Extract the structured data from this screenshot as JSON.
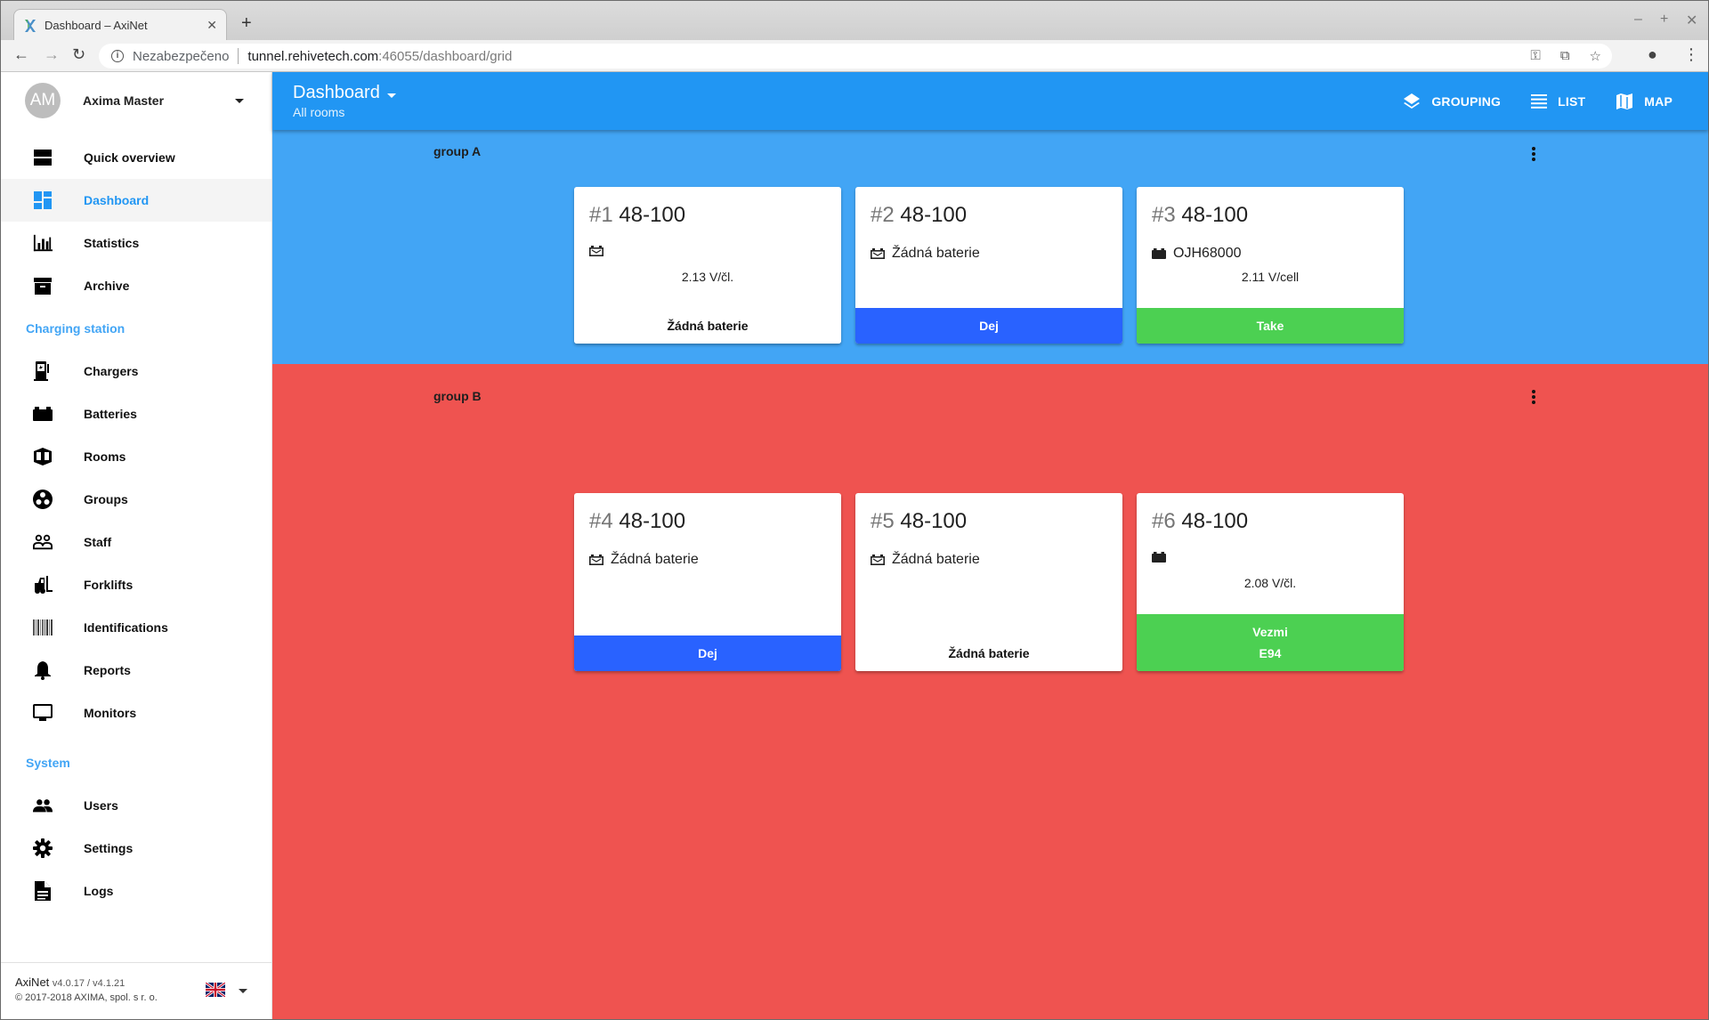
{
  "browser": {
    "tab_title": "Dashboard – AxiNet",
    "security_label": "Nezabezpečeno",
    "url_host": "tunnel.rehivetech.com",
    "url_path": ":46055/dashboard/grid"
  },
  "sidebar": {
    "user": {
      "initials": "AM",
      "name": "Axima Master"
    },
    "items_main": [
      {
        "label": "Quick overview",
        "icon": "view-agenda-icon",
        "active": false
      },
      {
        "label": "Dashboard",
        "icon": "dashboard-icon",
        "active": true
      },
      {
        "label": "Statistics",
        "icon": "bar-chart-icon",
        "active": false
      },
      {
        "label": "Archive",
        "icon": "archive-icon",
        "active": false
      }
    ],
    "section_charging": "Charging station",
    "items_charging": [
      {
        "label": "Chargers",
        "icon": "charger-icon"
      },
      {
        "label": "Batteries",
        "icon": "battery-icon"
      },
      {
        "label": "Rooms",
        "icon": "room-icon"
      },
      {
        "label": "Groups",
        "icon": "groups-icon"
      },
      {
        "label": "Staff",
        "icon": "staff-icon"
      },
      {
        "label": "Forklifts",
        "icon": "forklift-icon"
      },
      {
        "label": "Identifications",
        "icon": "barcode-icon"
      },
      {
        "label": "Reports",
        "icon": "bell-icon"
      },
      {
        "label": "Monitors",
        "icon": "monitor-icon"
      }
    ],
    "section_system": "System",
    "items_system": [
      {
        "label": "Users",
        "icon": "users-icon"
      },
      {
        "label": "Settings",
        "icon": "gear-icon"
      },
      {
        "label": "Logs",
        "icon": "document-icon"
      }
    ],
    "footer": {
      "app_name": "AxiNet",
      "version": "v4.0.17 / v4.1.21",
      "copyright": "© 2017-2018 AXIMA, spol. s r. o.",
      "language": "en-GB"
    }
  },
  "header": {
    "title": "Dashboard",
    "subtitle": "All rooms",
    "actions": [
      {
        "label": "GROUPING",
        "icon": "layers-icon"
      },
      {
        "label": "LIST",
        "icon": "list-icon"
      },
      {
        "label": "MAP",
        "icon": "map-icon"
      }
    ]
  },
  "groups": [
    {
      "name": "group A",
      "color": "#42A5F5",
      "chargers": [
        {
          "number": "#1",
          "model": "48-100",
          "battery_state": "empty",
          "battery_text": "",
          "voltage": "2.13 V/čl.",
          "action": "none",
          "action_label": "Žádná baterie",
          "action_sub": ""
        },
        {
          "number": "#2",
          "model": "48-100",
          "battery_state": "empty",
          "battery_text": "Žádná baterie",
          "voltage": "",
          "action": "give",
          "action_label": "Dej",
          "action_sub": ""
        },
        {
          "number": "#3",
          "model": "48-100",
          "battery_state": "present",
          "battery_text": "OJH68000",
          "voltage": "2.11 V/cell",
          "action": "take",
          "action_label": "Take",
          "action_sub": ""
        }
      ]
    },
    {
      "name": "group B",
      "color": "#EF5350",
      "chargers": [
        {
          "number": "#4",
          "model": "48-100",
          "battery_state": "empty",
          "battery_text": "Žádná baterie",
          "voltage": "",
          "action": "give",
          "action_label": "Dej",
          "action_sub": ""
        },
        {
          "number": "#5",
          "model": "48-100",
          "battery_state": "empty",
          "battery_text": "Žádná baterie",
          "voltage": "",
          "action": "none",
          "action_label": "Žádná baterie",
          "action_sub": ""
        },
        {
          "number": "#6",
          "model": "48-100",
          "battery_state": "present",
          "battery_text": "",
          "voltage": "2.08 V/čl.",
          "action": "take",
          "action_label": "Vezmi",
          "action_sub": "E94"
        }
      ]
    }
  ],
  "colors": {
    "primary": "#2196F3",
    "give": "#2962FF",
    "take": "#4CD052"
  }
}
